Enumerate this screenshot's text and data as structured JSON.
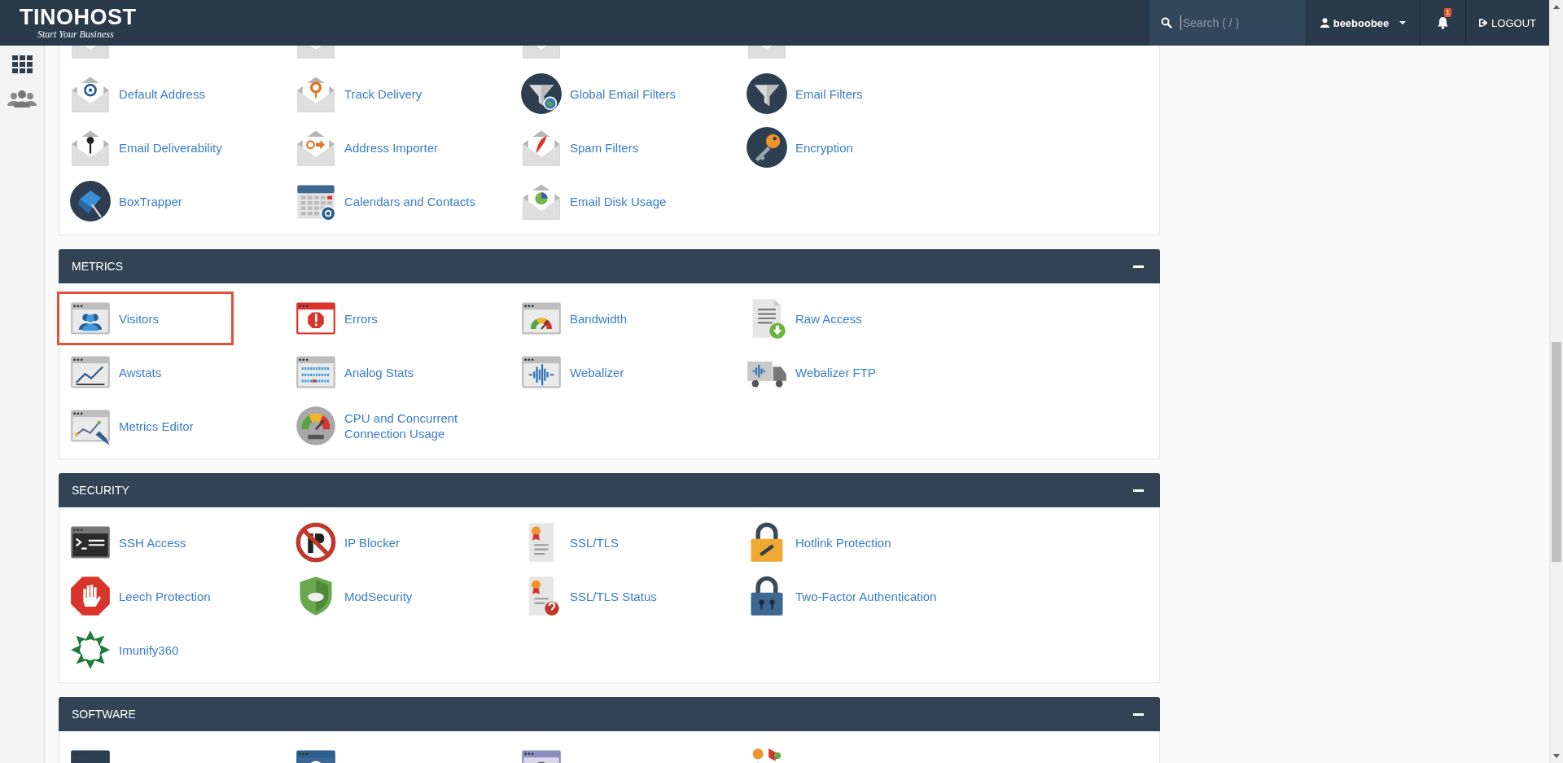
{
  "header": {
    "logo": "TINOHOST",
    "tagline": "Start Your Business",
    "search": {
      "placeholder": "Search ( / )"
    },
    "user": "beeboobee",
    "notifications": "1",
    "logout": "LOGOUT"
  },
  "sections": [
    {
      "items": [
        {
          "selected": false
        },
        {
          "selected": false
        },
        {
          "selected": false
        },
        {
          "selected": false
        },
        {
          "label": "Default Address",
          "selected": false
        },
        {
          "label": "Track Delivery",
          "selected": false
        },
        {
          "label": "Global Email Filters",
          "selected": false
        },
        {
          "label": "Email Filters",
          "selected": false
        },
        {
          "label": "Email Deliverability",
          "selected": false
        },
        {
          "label": "Address Importer",
          "selected": false
        },
        {
          "label": "Spam Filters",
          "selected": false
        },
        {
          "label": "Encryption",
          "selected": false
        },
        {
          "label": "BoxTrapper",
          "selected": false
        },
        {
          "label": "Calendars and Contacts",
          "selected": false
        },
        {
          "label": "Email Disk Usage",
          "selected": false
        }
      ]
    },
    {
      "title": "METRICS",
      "expanded": true,
      "items": [
        {
          "label": "Visitors",
          "selected": true
        },
        {
          "label": "Errors",
          "selected": false
        },
        {
          "label": "Bandwidth",
          "selected": false
        },
        {
          "label": "Raw Access",
          "selected": false
        },
        {
          "label": "Awstats",
          "selected": false
        },
        {
          "label": "Analog Stats",
          "selected": false
        },
        {
          "label": "Webalizer",
          "selected": false
        },
        {
          "label": "Webalizer FTP",
          "selected": false
        },
        {
          "label": "Metrics Editor",
          "selected": false
        },
        {
          "label": "CPU and Concurrent Connection Usage",
          "selected": false
        }
      ]
    },
    {
      "title": "SECURITY",
      "expanded": true,
      "items": [
        {
          "label": "SSH Access",
          "selected": false
        },
        {
          "label": "IP Blocker",
          "selected": false
        },
        {
          "label": "SSL/TLS",
          "selected": false
        },
        {
          "label": "Hotlink Protection",
          "selected": false
        },
        {
          "label": "Leech Protection",
          "selected": false
        },
        {
          "label": "ModSecurity",
          "selected": false
        },
        {
          "label": "SSL/TLS Status",
          "selected": false
        },
        {
          "label": "Two-Factor Authentication",
          "selected": false
        },
        {
          "label": "Imunify360",
          "selected": false
        }
      ]
    },
    {
      "title": "SOFTWARE",
      "expanded": true,
      "items": [
        {
          "selected": false
        },
        {
          "selected": false
        },
        {
          "selected": false
        },
        {
          "selected": false
        }
      ]
    }
  ]
}
